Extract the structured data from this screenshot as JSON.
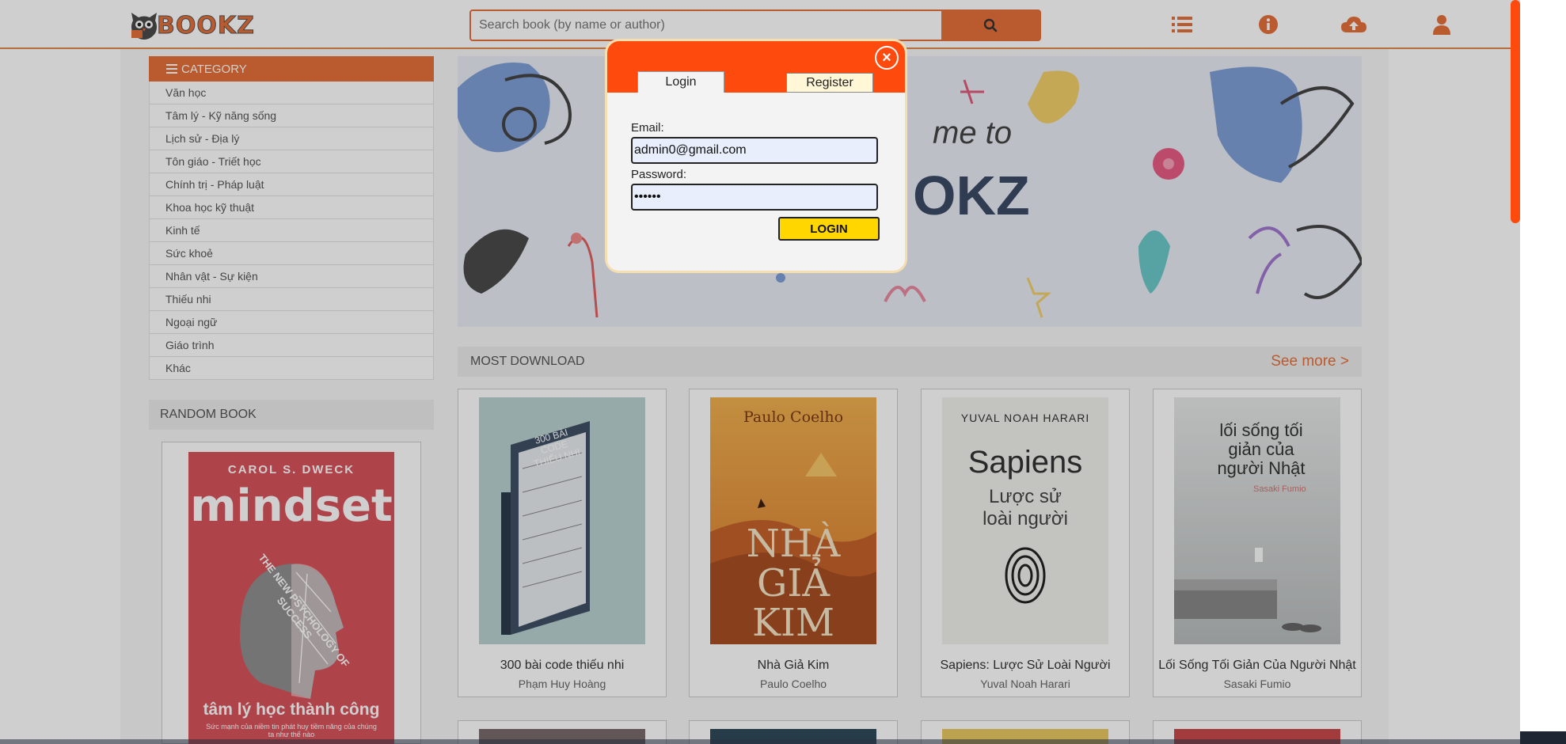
{
  "header": {
    "logo_text": "BOOKZ",
    "search_placeholder": "Search book (by name or author)",
    "icons": [
      "list-icon",
      "info-icon",
      "upload-cloud-icon",
      "user-icon"
    ]
  },
  "sidebar": {
    "category_title": "CATEGORY",
    "categories": [
      "Văn học",
      "Tâm lý - Kỹ năng sống",
      "Lịch sử - Địa lý",
      "Tôn giáo - Triết học",
      "Chính trị - Pháp luật",
      "Khoa học kỹ thuật",
      "Kinh tế",
      "Sức khoẻ",
      "Nhân vật - Sự kiện",
      "Thiếu nhi",
      "Ngoại ngữ",
      "Giáo trình",
      "Khác"
    ],
    "random_title": "RANDOM BOOK",
    "random_book": {
      "author": "CAROL S. DWECK",
      "title_big": "mindset",
      "arc_text": "THE NEW PSYCHOLOGY OF SUCCESS",
      "subtitle": "tâm lý học thành công",
      "tagline": "Sức mạnh của niềm tin phát huy tiềm năng của chúng ta như thế nào"
    }
  },
  "banner": {
    "text_line1": "me to",
    "text_line2": "OKZ"
  },
  "most_download": {
    "title": "MOST DOWNLOAD",
    "see_more": "See more >",
    "books": [
      {
        "title": "300 bài code thiếu nhi",
        "author": "Phạm Huy Hoàng",
        "cover_text": "300 BÀI CODE THIẾU NHI",
        "color": "#b9d2d0"
      },
      {
        "title": "Nhà Giả Kim",
        "author": "Paulo Coelho",
        "cover_top": "Paulo Coelho",
        "cover_text": "NHÀ GIẢ KIM",
        "color": "#e79a3e"
      },
      {
        "title": "Sapiens: Lược Sử Loài Người",
        "author": "Yuval Noah Harari",
        "cover_top": "YUVAL NOAH HARARI",
        "cover_big": "Sapiens",
        "cover_sub": "Lược sử loài người",
        "color": "#f1f0ec"
      },
      {
        "title": "Lối Sống Tối Giản Của Người Nhật",
        "author": "Sasaki Fumio",
        "cover_text": "lối sống tối giản của người Nhật",
        "cover_small": "Sasaki Fumio",
        "color": "#cfd2d2"
      }
    ]
  },
  "modal": {
    "tab_login": "Login",
    "tab_register": "Register",
    "email_label": "Email:",
    "email_value": "admin0@gmail.com",
    "password_label": "Password:",
    "password_value": "••••••",
    "login_button": "LOGIN",
    "close_symbol": "×"
  },
  "colors": {
    "accent": "#e4703a",
    "modal_header": "#ff4a0e",
    "login_button": "#ffd600"
  }
}
